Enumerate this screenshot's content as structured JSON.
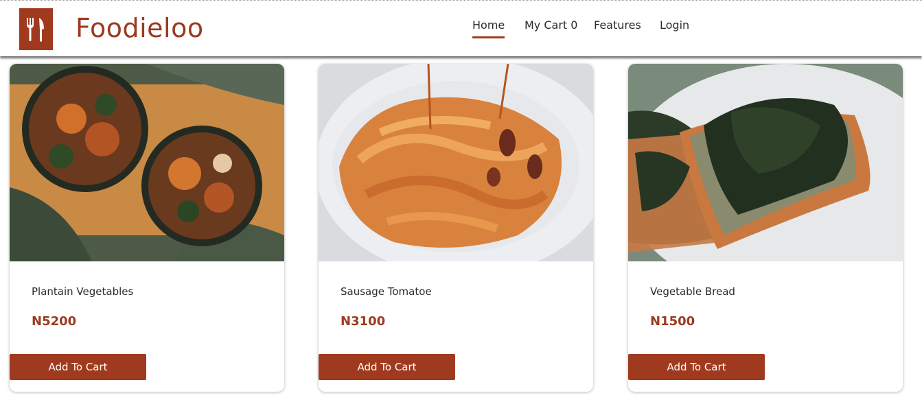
{
  "header": {
    "brand": "Foodieloo",
    "logo_icon": "fork-knife-icon",
    "nav": [
      {
        "label": "Home",
        "active": true
      },
      {
        "label": "My Cart 0",
        "active": false
      },
      {
        "label": "Features",
        "active": false
      },
      {
        "label": "Login",
        "active": false
      }
    ]
  },
  "products": [
    {
      "name": "Plantain Vegetables",
      "price": "N5200",
      "button": "Add To Cart",
      "image": "plantain-vegetable-bowls-photo"
    },
    {
      "name": "Sausage Tomatoe",
      "price": "N3100",
      "button": "Add To Cart",
      "image": "tomato-pasta-plate-photo"
    },
    {
      "name": "Vegetable Bread",
      "price": "N1500",
      "button": "Add To Cart",
      "image": "spinach-toast-photo"
    }
  ],
  "colors": {
    "brand": "#9c3a1f",
    "button": "#a03a1f",
    "text": "#2b2b2b"
  }
}
